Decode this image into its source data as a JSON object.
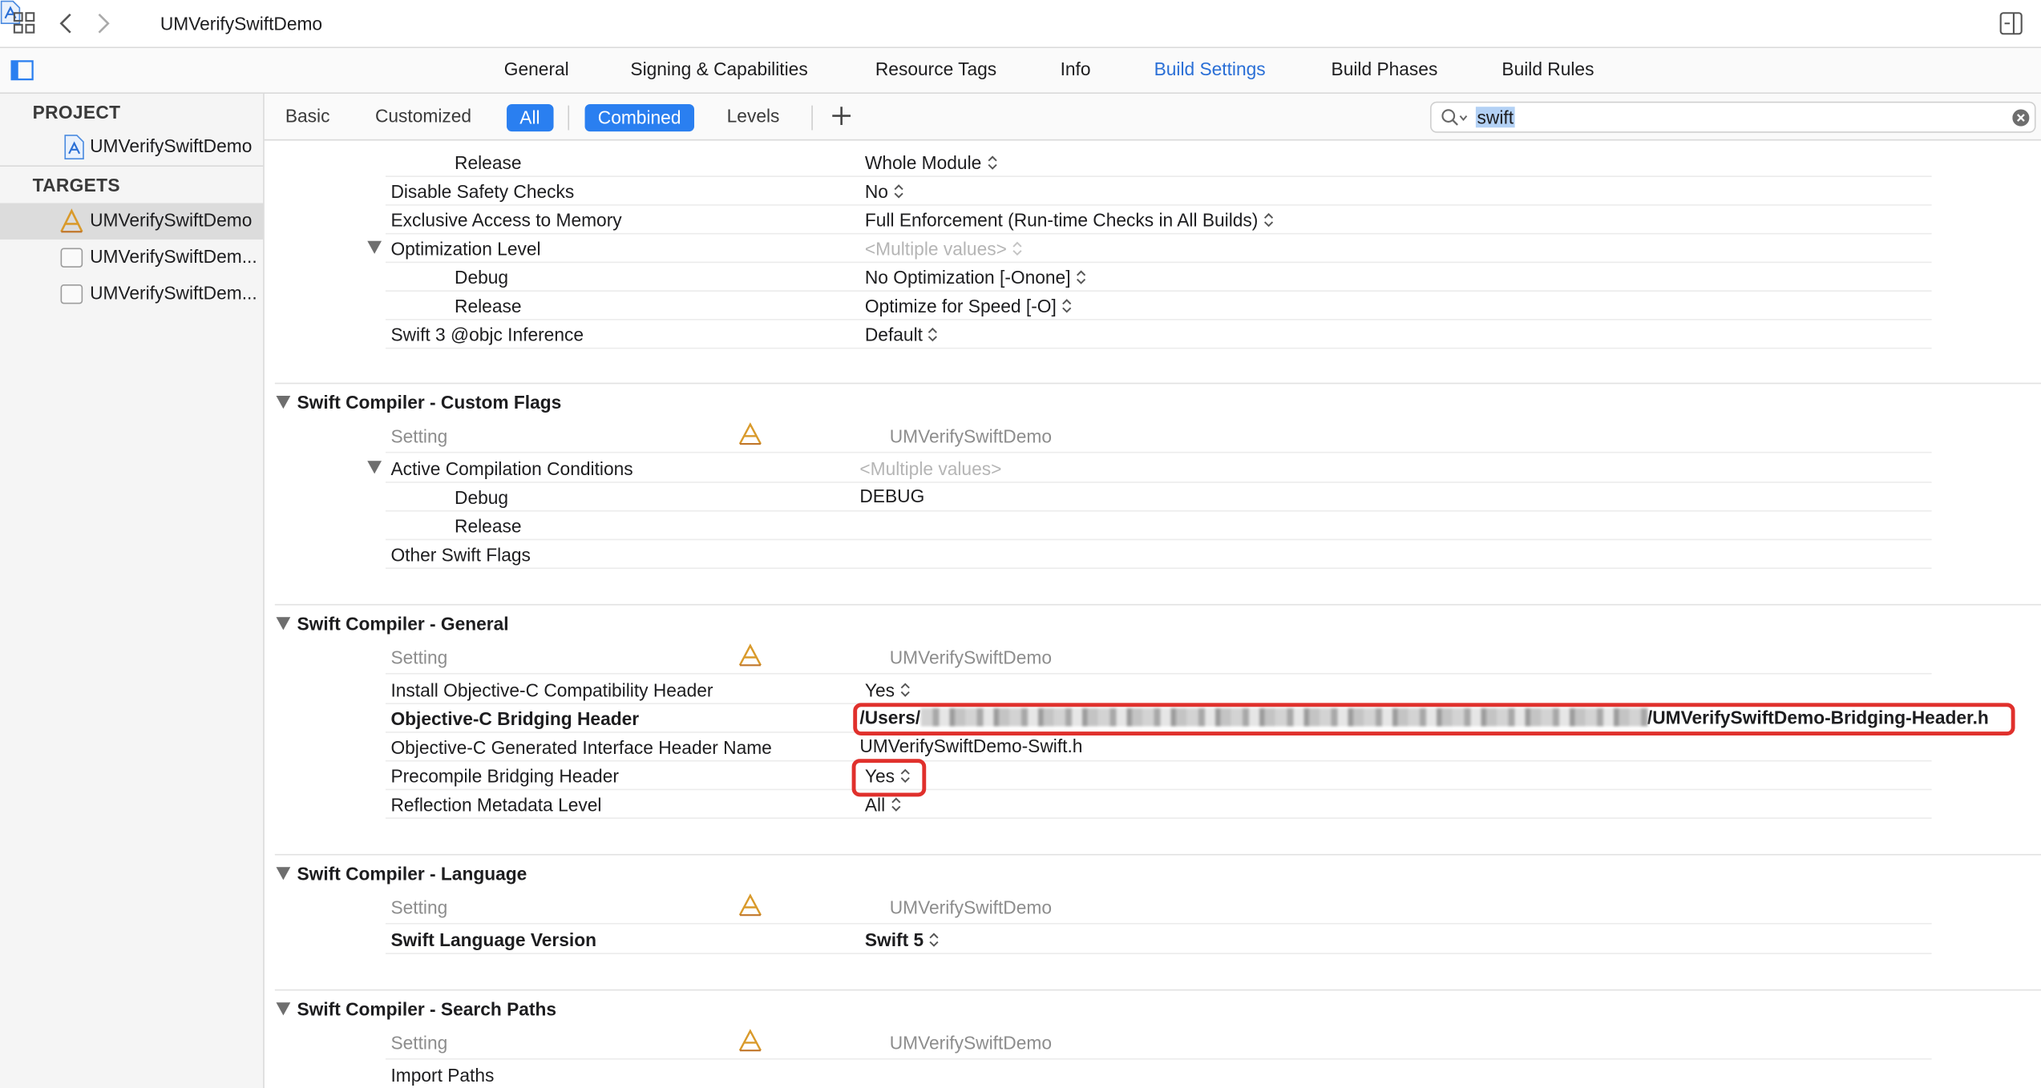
{
  "window": {
    "title": "UMVerifySwiftDemo"
  },
  "tabs": [
    {
      "label": "General"
    },
    {
      "label": "Signing & Capabilities"
    },
    {
      "label": "Resource Tags"
    },
    {
      "label": "Info"
    },
    {
      "label": "Build Settings",
      "active": true
    },
    {
      "label": "Build Phases"
    },
    {
      "label": "Build Rules"
    }
  ],
  "sidebar": {
    "project_header": "PROJECT",
    "project_item": "UMVerifySwiftDemo",
    "targets_header": "TARGETS",
    "targets": [
      {
        "label": "UMVerifySwiftDemo",
        "selected": true
      },
      {
        "label": "UMVerifySwiftDem..."
      },
      {
        "label": "UMVerifySwiftDem..."
      }
    ]
  },
  "filterbar": {
    "basic": "Basic",
    "customized": "Customized",
    "all": "All",
    "combined": "Combined",
    "levels": "Levels",
    "search_value": "swift"
  },
  "top_rows": [
    {
      "name": "Release",
      "value": "Whole Module",
      "sub": true,
      "stepper": true
    },
    {
      "name": "Disable Safety Checks",
      "value": "No",
      "stepper": true
    },
    {
      "name": "Exclusive Access to Memory",
      "value": "Full Enforcement (Run-time Checks in All Builds)",
      "stepper": true
    },
    {
      "name": "Optimization Level",
      "value": "<Multiple values>",
      "muted": true,
      "expanded": true,
      "stepper": true
    },
    {
      "name": "Debug",
      "value": "No Optimization [-Onone]",
      "sub": true,
      "stepper": true
    },
    {
      "name": "Release",
      "value": "Optimize for Speed [-O]",
      "sub": true,
      "stepper": true
    },
    {
      "name": "Swift 3 @objc Inference",
      "value": "Default",
      "stepper": true
    }
  ],
  "sections": {
    "custom_flags": {
      "title": "Swift Compiler - Custom Flags",
      "setting_label": "Setting",
      "target_label": "UMVerifySwiftDemo",
      "rows": [
        {
          "name": "Active Compilation Conditions",
          "value": "<Multiple values>"
        },
        {
          "name": "Debug",
          "value": "DEBUG"
        },
        {
          "name": "Release",
          "value": ""
        },
        {
          "name": "Other Swift Flags",
          "value": ""
        }
      ]
    },
    "general": {
      "title": "Swift Compiler - General",
      "setting_label": "Setting",
      "target_label": "UMVerifySwiftDemo",
      "rows": [
        {
          "name": "Install Objective-C Compatibility Header",
          "value": "Yes"
        },
        {
          "name": "Objective-C Bridging Header",
          "value_prefix": "/Users/",
          "value_suffix": "/UMVerifySwiftDemo-Bridging-Header.h"
        },
        {
          "name": "Objective-C Generated Interface Header Name",
          "value": "UMVerifySwiftDemo-Swift.h"
        },
        {
          "name": "Precompile Bridging Header",
          "value": "Yes"
        },
        {
          "name": "Reflection Metadata Level",
          "value": "All"
        }
      ]
    },
    "language": {
      "title": "Swift Compiler - Language",
      "setting_label": "Setting",
      "target_label": "UMVerifySwiftDemo",
      "rows": [
        {
          "name": "Swift Language Version",
          "value": "Swift 5"
        }
      ]
    },
    "search_paths": {
      "title": "Swift Compiler - Search Paths",
      "setting_label": "Setting",
      "target_label": "UMVerifySwiftDemo",
      "rows": [
        {
          "name": "Import Paths",
          "value": ""
        }
      ]
    }
  },
  "colors": {
    "accent": "#2a7ff0",
    "active_tab": "#2a6fd6",
    "highlight_box": "#e0302c"
  },
  "icons": {
    "grid": "grid-icon",
    "back": "chevron-left-icon",
    "forward": "chevron-right-icon",
    "file": "swift-project-file-icon",
    "inspector": "inspector-toggle-icon",
    "sidebar": "sidebar-toggle-icon",
    "search": "search-icon",
    "clear": "clear-search-icon",
    "add": "plus-icon",
    "target": "app-target-icon"
  }
}
